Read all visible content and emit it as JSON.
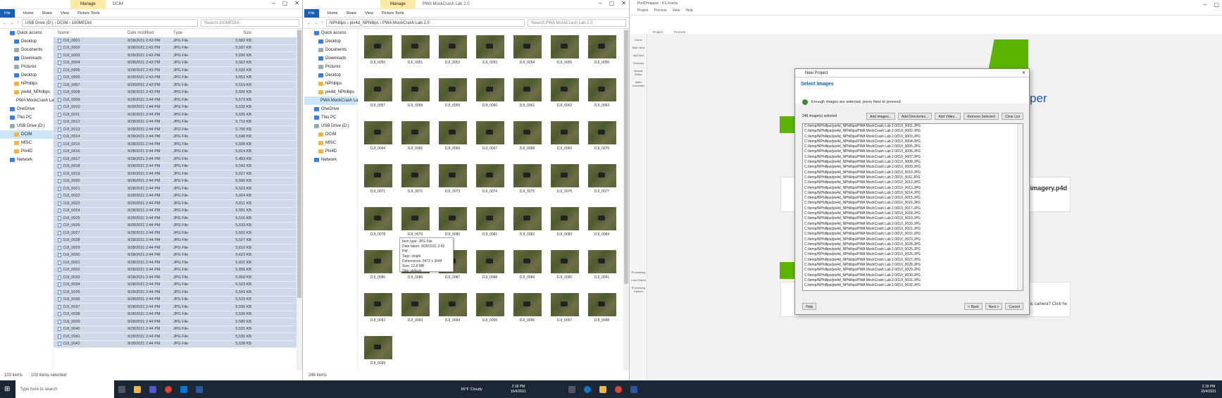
{
  "win1": {
    "manage_tab": "Manage",
    "title": "DCIM",
    "ribbon_tabs": [
      "File",
      "Home",
      "Share",
      "View",
      "Picture Tools"
    ],
    "path": "USB Drive (D:) › DCIM › 100MEDIA",
    "search_placeholder": "Search 100MEDIA",
    "nav": [
      "Quick access",
      "Desktop",
      "Documents",
      "Downloads",
      "Pictures",
      "Desktop",
      "NPhillips",
      "pix4d_NPhillips",
      "PWA MockCrash La",
      "OneDrive",
      "This PC",
      "USB Drive (D:)",
      "DCIM",
      "MISC",
      "Pix4D",
      "Network"
    ],
    "columns": [
      "Name",
      "Date modified",
      "Type",
      "Size"
    ],
    "rows": [
      [
        "DJI_0001",
        "9/28/2021 2:43 PM",
        "JPG File",
        "5,582 KB"
      ],
      [
        "DJI_0002",
        "9/28/2021 2:43 PM",
        "JPG File",
        "5,597 KB"
      ],
      [
        "DJI_0003",
        "9/28/2021 2:43 PM",
        "JPG File",
        "5,590 KB"
      ],
      [
        "DJI_0004",
        "9/28/2021 2:43 PM",
        "JPG File",
        "5,562 KB"
      ],
      [
        "DJI_0005",
        "9/28/2021 2:43 PM",
        "JPG File",
        "5,530 KB"
      ],
      [
        "DJI_0006",
        "9/28/2021 2:43 PM",
        "JPG File",
        "5,552 KB"
      ],
      [
        "DJI_0007",
        "9/28/2021 2:43 PM",
        "JPG File",
        "5,519 KB"
      ],
      [
        "DJI_0008",
        "9/28/2021 2:43 PM",
        "JPG File",
        "5,556 KB"
      ],
      [
        "DJI_0009",
        "9/28/2021 2:44 PM",
        "JPG File",
        "5,573 KB"
      ],
      [
        "DJI_0010",
        "9/28/2021 2:44 PM",
        "JPG File",
        "5,532 KB"
      ],
      [
        "DJI_0011",
        "9/28/2021 2:44 PM",
        "JPG File",
        "5,535 KB"
      ],
      [
        "DJI_0012",
        "9/28/2021 2:44 PM",
        "JPG File",
        "5,710 KB"
      ],
      [
        "DJI_0013",
        "9/28/2021 2:44 PM",
        "JPG File",
        "5,706 KB"
      ],
      [
        "DJI_0014",
        "9/28/2021 2:44 PM",
        "JPG File",
        "5,548 KB"
      ],
      [
        "DJI_0015",
        "9/28/2021 2:44 PM",
        "JPG File",
        "5,508 KB"
      ],
      [
        "DJI_0016",
        "9/28/2021 2:44 PM",
        "JPG File",
        "5,514 KB"
      ],
      [
        "DJI_0017",
        "9/28/2021 2:44 PM",
        "JPG File",
        "5,483 KB"
      ],
      [
        "DJI_0018",
        "9/28/2021 2:44 PM",
        "JPG File",
        "5,542 KB"
      ],
      [
        "DJI_0019",
        "9/28/2021 2:44 PM",
        "JPG File",
        "5,527 KB"
      ],
      [
        "DJI_0020",
        "9/28/2021 2:44 PM",
        "JPG File",
        "5,596 KB"
      ],
      [
        "DJI_0021",
        "9/28/2021 2:44 PM",
        "JPG File",
        "5,523 KB"
      ],
      [
        "DJI_0022",
        "9/28/2021 2:44 PM",
        "JPG File",
        "5,604 KB"
      ],
      [
        "DJI_0023",
        "9/28/2021 2:44 PM",
        "JPG File",
        "5,611 KB"
      ],
      [
        "DJI_0024",
        "9/28/2021 2:44 PM",
        "JPG File",
        "5,581 KB"
      ],
      [
        "DJI_0025",
        "9/28/2021 2:44 PM",
        "JPG File",
        "5,516 KB"
      ],
      [
        "DJI_0026",
        "9/28/2021 2:44 PM",
        "JPG File",
        "5,533 KB"
      ],
      [
        "DJI_0027",
        "9/28/2021 2:44 PM",
        "JPG File",
        "5,502 KB"
      ],
      [
        "DJI_0028",
        "9/28/2021 2:44 PM",
        "JPG File",
        "5,527 KB"
      ],
      [
        "DJI_0029",
        "9/28/2021 2:44 PM",
        "JPG File",
        "5,610 KB"
      ],
      [
        "DJI_0030",
        "9/28/2021 2:44 PM",
        "JPG File",
        "5,623 KB"
      ],
      [
        "DJI_0031",
        "9/28/2021 2:44 PM",
        "JPG File",
        "5,601 KB"
      ],
      [
        "DJI_0032",
        "9/28/2021 2:44 PM",
        "JPG File",
        "5,555 KB"
      ],
      [
        "DJI_0033",
        "9/28/2021 2:44 PM",
        "JPG File",
        "5,558 KB"
      ],
      [
        "DJI_0034",
        "9/28/2021 2:44 PM",
        "JPG File",
        "5,523 KB"
      ],
      [
        "DJI_0035",
        "9/28/2021 2:44 PM",
        "JPG File",
        "5,543 KB"
      ],
      [
        "DJI_0036",
        "9/28/2021 2:44 PM",
        "JPG File",
        "5,533 KB"
      ],
      [
        "DJI_0037",
        "9/28/2021 2:44 PM",
        "JPG File",
        "5,590 KB"
      ],
      [
        "DJI_0038",
        "9/28/2021 2:44 PM",
        "JPG File",
        "5,536 KB"
      ],
      [
        "DJI_0039",
        "9/28/2021 2:44 PM",
        "JPG File",
        "5,580 KB"
      ],
      [
        "DJI_0040",
        "9/28/2021 2:44 PM",
        "JPG File",
        "5,531 KB"
      ],
      [
        "DJI_0041",
        "9/28/2021 2:44 PM",
        "JPG File",
        "5,535 KB"
      ],
      [
        "DJI_0042",
        "9/28/2021 2:44 PM",
        "JPG File",
        "5,538 KB"
      ]
    ],
    "status_items": "103 items",
    "status_selected": "103 items selected"
  },
  "win2": {
    "manage_tab": "Manage",
    "title": "PWA MockCrash Lab 2.0",
    "ribbon_tabs": [
      "File",
      "Home",
      "Share",
      "View",
      "Picture Tools"
    ],
    "path": "NPhillips › pix4d_NPhillips › PWA MockCrash Lab 2.0",
    "search_placeholder": "Search PWA MockCrash Lab 2.0",
    "nav": [
      "Quick access",
      "Desktop",
      "Documents",
      "Downloads",
      "Pictures",
      "Desktop",
      "NPhillips",
      "pix4d_NPhillips",
      "PWA MockCrash La",
      "OneDrive",
      "This PC",
      "USB Drive (D:)",
      "DCIM",
      "MISC",
      "Pix4D",
      "Network"
    ],
    "thumbs": [
      "DJI_0050",
      "DJI_0051",
      "DJI_0052",
      "DJI_0053",
      "DJI_0054",
      "DJI_0055",
      "DJI_0056",
      "DJI_0057",
      "DJI_0058",
      "DJI_0059",
      "DJI_0060",
      "DJI_0061",
      "DJI_0062",
      "DJI_0063",
      "DJI_0064",
      "DJI_0065",
      "DJI_0066",
      "DJI_0067",
      "DJI_0068",
      "DJI_0069",
      "DJI_0070",
      "DJI_0071",
      "DJI_0072",
      "DJI_0073",
      "DJI_0074",
      "DJI_0075",
      "DJI_0076",
      "DJI_0077",
      "DJI_0078",
      "DJI_0079",
      "DJI_0080",
      "DJI_0081",
      "DJI_0082",
      "DJI_0083",
      "DJI_0084",
      "DJI_0085",
      "DJI_0086",
      "DJI_0087",
      "DJI_0088",
      "DJI_0089",
      "DJI_0090",
      "DJI_0091",
      "DJI_0092",
      "DJI_0093",
      "DJI_0094",
      "DJI_0095",
      "DJI_0096",
      "DJI_0097",
      "DJI_0098",
      "DJI_0099"
    ],
    "tooltip": [
      "Item type: JPG File",
      "Date taken: 9/28/2021 2:43 PM",
      "Tags: single",
      "Dimensions: 5472 x 3648",
      "Size: 12.8 MB",
      "Title: default"
    ],
    "status_items": "248 items"
  },
  "pix": {
    "title": "Pix4Dmapper - 4.6.4.beta",
    "menu": [
      "Project",
      "Process",
      "View",
      "Help"
    ],
    "toolbar": [
      "Project",
      "Process"
    ],
    "side": [
      "Home",
      "Map View",
      "rayCloud",
      "Volumes",
      "Mosaic Editor",
      "Index Calculator",
      "Processing",
      "Last Output",
      "Processing Options"
    ],
    "big_title": "per",
    "recent_file": "imagery.p4d",
    "partial_text": "ic camera? Click he",
    "dialog": {
      "title": "New Project",
      "header": "Select Images",
      "msg": "Enough images are selected, press Next to proceed.",
      "count": "248 image(s) selected",
      "buttons": [
        "Add Images...",
        "Add Directories...",
        "Add Video...",
        "Remove Selected",
        "Clear List"
      ],
      "files": [
        "C:/temp/NPhillips/pix4d_NPhillips/PWA MockCrash Lab 2.0/DJI_0001.JPG",
        "C:/temp/NPhillips/pix4d_NPhillips/PWA MockCrash Lab 2.0/DJI_0002.JPG",
        "C:/temp/NPhillips/pix4d_NPhillips/PWA MockCrash Lab 2.0/DJI_0003.JPG",
        "C:/temp/NPhillips/pix4d_NPhillips/PWA MockCrash Lab 2.0/DJI_0004.JPG",
        "C:/temp/NPhillips/pix4d_NPhillips/PWA MockCrash Lab 2.0/DJI_0005.JPG",
        "C:/temp/NPhillips/pix4d_NPhillips/PWA MockCrash Lab 2.0/DJI_0006.JPG",
        "C:/temp/NPhillips/pix4d_NPhillips/PWA MockCrash Lab 2.0/DJI_0007.JPG",
        "C:/temp/NPhillips/pix4d_NPhillips/PWA MockCrash Lab 2.0/DJI_0008.JPG",
        "C:/temp/NPhillips/pix4d_NPhillips/PWA MockCrash Lab 2.0/DJI_0009.JPG",
        "C:/temp/NPhillips/pix4d_NPhillips/PWA MockCrash Lab 2.0/DJI_0010.JPG",
        "C:/temp/NPhillips/pix4d_NPhillips/PWA MockCrash Lab 2.0/DJI_0011.JPG",
        "C:/temp/NPhillips/pix4d_NPhillips/PWA MockCrash Lab 2.0/DJI_0012.JPG",
        "C:/temp/NPhillips/pix4d_NPhillips/PWA MockCrash Lab 2.0/DJI_0013.JPG",
        "C:/temp/NPhillips/pix4d_NPhillips/PWA MockCrash Lab 2.0/DJI_0014.JPG",
        "C:/temp/NPhillips/pix4d_NPhillips/PWA MockCrash Lab 2.0/DJI_0015.JPG",
        "C:/temp/NPhillips/pix4d_NPhillips/PWA MockCrash Lab 2.0/DJI_0016.JPG",
        "C:/temp/NPhillips/pix4d_NPhillips/PWA MockCrash Lab 2.0/DJI_0017.JPG",
        "C:/temp/NPhillips/pix4d_NPhillips/PWA MockCrash Lab 2.0/DJI_0018.JPG",
        "C:/temp/NPhillips/pix4d_NPhillips/PWA MockCrash Lab 2.0/DJI_0019.JPG",
        "C:/temp/NPhillips/pix4d_NPhillips/PWA MockCrash Lab 2.0/DJI_0020.JPG",
        "C:/temp/NPhillips/pix4d_NPhillips/PWA MockCrash Lab 2.0/DJI_0021.JPG",
        "C:/temp/NPhillips/pix4d_NPhillips/PWA MockCrash Lab 2.0/DJI_0022.JPG",
        "C:/temp/NPhillips/pix4d_NPhillips/PWA MockCrash Lab 2.0/DJI_0023.JPG",
        "C:/temp/NPhillips/pix4d_NPhillips/PWA MockCrash Lab 2.0/DJI_0024.JPG",
        "C:/temp/NPhillips/pix4d_NPhillips/PWA MockCrash Lab 2.0/DJI_0025.JPG",
        "C:/temp/NPhillips/pix4d_NPhillips/PWA MockCrash Lab 2.0/DJI_0026.JPG",
        "C:/temp/NPhillips/pix4d_NPhillips/PWA MockCrash Lab 2.0/DJI_0027.JPG",
        "C:/temp/NPhillips/pix4d_NPhillips/PWA MockCrash Lab 2.0/DJI_0028.JPG",
        "C:/temp/NPhillips/pix4d_NPhillips/PWA MockCrash Lab 2.0/DJI_0029.JPG",
        "C:/temp/NPhillips/pix4d_NPhillips/PWA MockCrash Lab 2.0/DJI_0030.JPG",
        "C:/temp/NPhillips/pix4d_NPhillips/PWA MockCrash Lab 2.0/DJI_0031.JPG",
        "C:/temp/NPhillips/pix4d_NPhillips/PWA MockCrash Lab 2.0/DJI_0032.JPG"
      ],
      "help": "Help",
      "back": "< Back",
      "next": "Next >",
      "cancel": "Cancel"
    }
  },
  "taskbar": {
    "search_placeholder": "Type here to search",
    "weather": "56°F Cloudy",
    "time_left": "2:18 PM",
    "date_left": "10/4/2021",
    "time_right": "2:18 PM",
    "date_right": "10/4/2021"
  }
}
